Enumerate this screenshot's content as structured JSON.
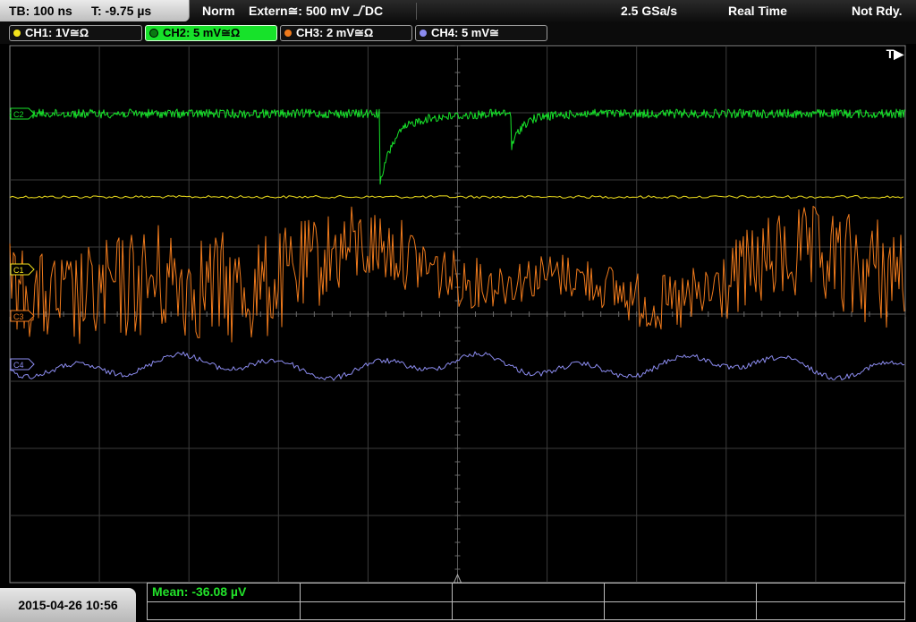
{
  "status": {
    "timebase": "TB: 100 ns",
    "trigger_time": "T: -9.75 µs",
    "mode": "Norm",
    "trigger": "Extern≅: 500 mV",
    "trigger_coupling": "DC",
    "sample_rate": "2.5 GSa/s",
    "acquisition": "Real Time",
    "state": "Not Rdy."
  },
  "channels": [
    {
      "label": "CH1: 1V≅Ω",
      "color": "#f2e21c",
      "active": false
    },
    {
      "label": "CH2: 5 mV≅Ω",
      "color": "#17e22a",
      "active": true
    },
    {
      "label": "CH3: 2 mV≅Ω",
      "color": "#ef7a1c",
      "active": false
    },
    {
      "label": "CH4: 5 mV≅",
      "color": "#8c8cf0",
      "active": false
    }
  ],
  "markers": {
    "trigger": "T▶",
    "ch2": "C2",
    "ch1": "C1",
    "ch3": "C3",
    "ch4": "C4"
  },
  "colors": {
    "ch1": "#f2e21c",
    "ch2": "#17e22a",
    "ch3": "#ef7a1c",
    "ch4": "#8c8cf0",
    "grid": "#3c3c3c"
  },
  "footer": {
    "datetime": "2015-04-26 10:56",
    "measurement": "Mean: -36.08 µV"
  }
}
